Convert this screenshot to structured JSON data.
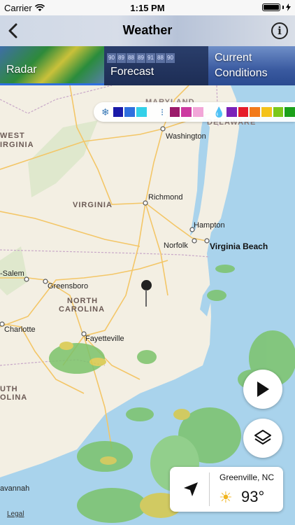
{
  "status_bar": {
    "carrier": "Carrier",
    "time": "1:15 PM",
    "battery_percent": 100
  },
  "nav": {
    "title": "Weather",
    "back_icon": "chevron-left-icon",
    "info_icon": "info-icon"
  },
  "tabs": [
    {
      "label": "Radar",
      "selected": true
    },
    {
      "label": "Forecast",
      "selected": false
    },
    {
      "label": "Current Conditions",
      "selected": false
    }
  ],
  "forecast_tab_cells": [
    "90",
    "89",
    "88",
    "89",
    "91",
    "88",
    "90"
  ],
  "legend": {
    "snow_colors": [
      "#1a1aa8",
      "#2f6fde",
      "#33d0e8"
    ],
    "mix_colors": [
      "#9b1a6a",
      "#cc3aa0",
      "#f2a6d8"
    ],
    "rain_colors": [
      "#7a22b8",
      "#e61c2a",
      "#f27a1a",
      "#f4c21a",
      "#7ac81a",
      "#1aa01a"
    ]
  },
  "map": {
    "states": [
      "MARYLAND",
      "DELAWARE",
      "WEST VIRGINIA",
      "VIRGINIA",
      "NORTH CAROLINA",
      "SOUTH CAROLINA"
    ],
    "state_display": {
      "maryland": "MARYLAND",
      "delaware": "DELAWARE",
      "west_1": "WEST",
      "west_2": "IRGINIA",
      "virginia": "VIRGINIA",
      "north_1": "NORTH",
      "north_2": "CAROLINA",
      "south_1": "UTH",
      "south_2": "OLINA"
    },
    "cities": {
      "washington": "Washington",
      "richmond": "Richmond",
      "hampton": "Hampton",
      "norfolk": "Norfolk",
      "virginia_beach": "Virginia Beach",
      "salem": "-Salem",
      "greensboro": "Greensboro",
      "charlotte": "Charlotte",
      "fayetteville": "Fayetteville",
      "savannah": "avannah"
    }
  },
  "location_card": {
    "place": "Greenville, NC",
    "temperature": "93°",
    "condition_icon": "sun-icon"
  },
  "legal": "Legal"
}
